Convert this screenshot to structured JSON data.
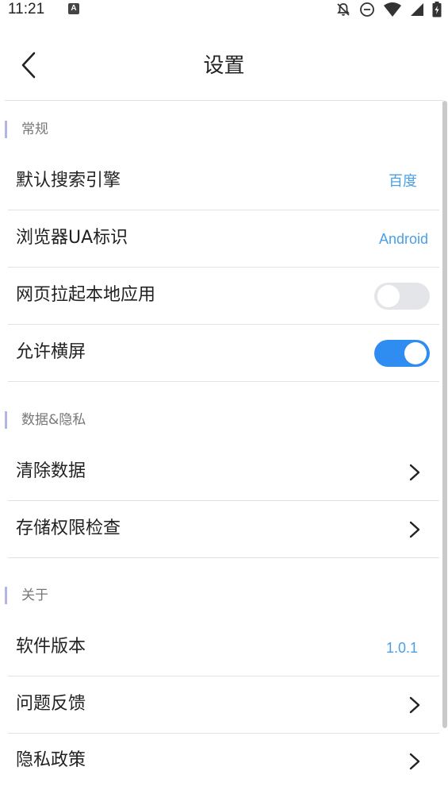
{
  "status_bar": {
    "time": "11:21",
    "badge": "A",
    "icons": [
      "notifications-off-icon",
      "do-not-disturb-icon",
      "wifi-icon",
      "cell-signal-icon",
      "battery-charging-icon"
    ]
  },
  "header": {
    "title": "设置",
    "back_icon": "back-arrow-icon"
  },
  "sections": [
    {
      "title": "常规",
      "items": [
        {
          "label": "默认搜索引擎",
          "value": "百度"
        },
        {
          "label": "浏览器UA标识",
          "value": "Android"
        },
        {
          "label": "网页拉起本地应用",
          "toggle": false
        },
        {
          "label": "允许横屏",
          "toggle": true
        }
      ]
    },
    {
      "title": "数据&隐私",
      "items": [
        {
          "label": "清除数据",
          "icon": "chevron-right-icon"
        },
        {
          "label": "存储权限检查",
          "icon": "chevron-right-icon"
        }
      ]
    },
    {
      "title": "关于",
      "items": [
        {
          "label": "软件版本",
          "value": "1.0.1"
        },
        {
          "label": "问题反馈",
          "icon": "chevron-right-icon"
        },
        {
          "label": "隐私政策",
          "icon": "chevron-right-icon"
        }
      ]
    }
  ],
  "colors": {
    "accent": "#4a9fe8",
    "toggle_on": "#2f8cf0",
    "toggle_off": "#e4e5e9",
    "section_bar": "#b4b4e8"
  }
}
